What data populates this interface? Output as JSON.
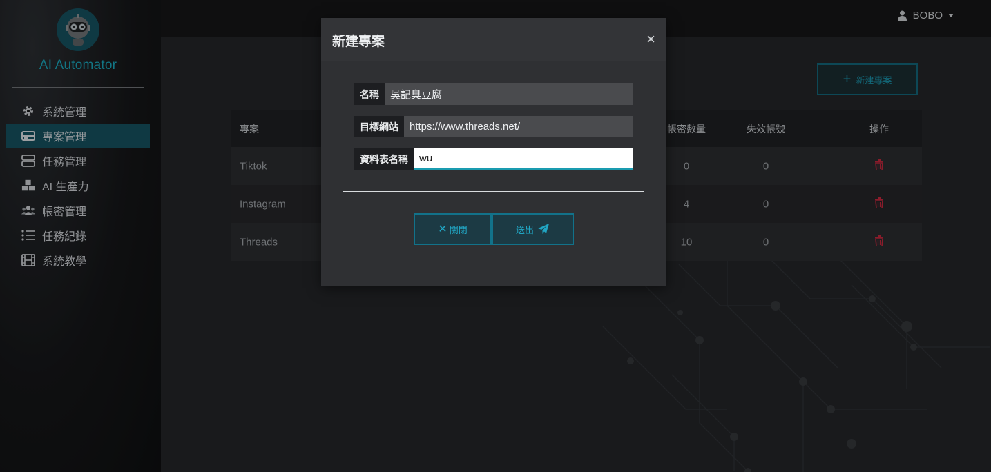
{
  "app": {
    "logo_text": "AI Automator"
  },
  "sidebar": {
    "items": [
      {
        "label": "系統管理",
        "icon": "gear-icon"
      },
      {
        "label": "專案管理",
        "icon": "drive-icon",
        "active": true
      },
      {
        "label": "任務管理",
        "icon": "server-icon"
      },
      {
        "label": "AI 生產力",
        "icon": "cubes-icon"
      },
      {
        "label": "帳密管理",
        "icon": "users-icon"
      },
      {
        "label": "任務紀錄",
        "icon": "list-icon"
      },
      {
        "label": "系統教學",
        "icon": "film-icon"
      }
    ]
  },
  "topbar": {
    "user_name": "BOBO"
  },
  "main": {
    "new_project_label": "新建專案",
    "table": {
      "headers": {
        "project": "專案",
        "account_count": "帳密數量",
        "invalid_accounts": "失效帳號",
        "actions": "操作"
      },
      "rows": [
        {
          "name": "Tiktok",
          "account_count": "0",
          "invalid": "0"
        },
        {
          "name": "Instagram",
          "account_count": "4",
          "invalid": "0"
        },
        {
          "name": "Threads",
          "account_count": "10",
          "invalid": "0"
        }
      ]
    }
  },
  "modal": {
    "title": "新建專案",
    "fields": {
      "name_label": "名稱",
      "name_value": "吳記臭豆腐",
      "url_label": "目標網站",
      "url_value": "https://www.threads.net/",
      "table_label": "資料表名稱",
      "table_value": "wu"
    },
    "close_label": "關閉",
    "send_label": "送出"
  },
  "colors": {
    "accent": "#1aa3b8",
    "danger": "#c0283c",
    "active_nav": "#16505e"
  }
}
